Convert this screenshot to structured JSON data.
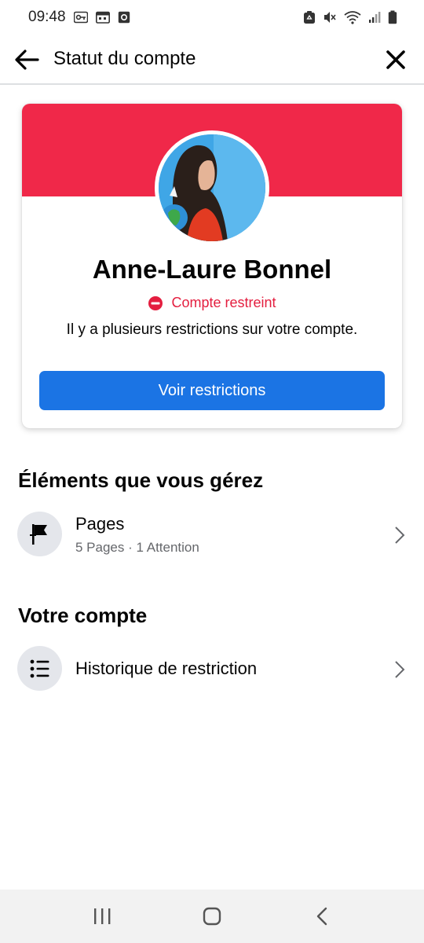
{
  "status_bar": {
    "time": "09:48",
    "left_icons": [
      "key-icon",
      "calendar-icon",
      "record-icon"
    ],
    "right_icons": [
      "recycle-icon",
      "mute-icon",
      "wifi-icon",
      "signal-icon",
      "battery-icon"
    ]
  },
  "header": {
    "title": "Statut du compte",
    "back_icon": "back-arrow-icon",
    "close_icon": "close-icon"
  },
  "profile": {
    "name": "Anne-Laure Bonnel",
    "status": "Compte restreint",
    "description": "Il y a plusieurs restrictions sur votre compte.",
    "button_label": "Voir restrictions"
  },
  "managed": {
    "title": "Éléments que vous gérez",
    "items": [
      {
        "label": "Pages",
        "subtitle": "5 Pages · 1 Attention",
        "icon": "flag-icon"
      }
    ]
  },
  "account": {
    "title": "Votre compte",
    "items": [
      {
        "label": "Historique de restriction",
        "icon": "list-icon"
      }
    ]
  },
  "colors": {
    "banner": "#f02849",
    "status_red": "#e41e3f",
    "button_blue": "#1b74e4",
    "row_icon_bg": "#e4e6eb",
    "subtitle_gray": "#65676b"
  },
  "nav_bar": {
    "buttons": [
      "recent-apps-icon",
      "home-icon",
      "back-nav-icon"
    ]
  }
}
